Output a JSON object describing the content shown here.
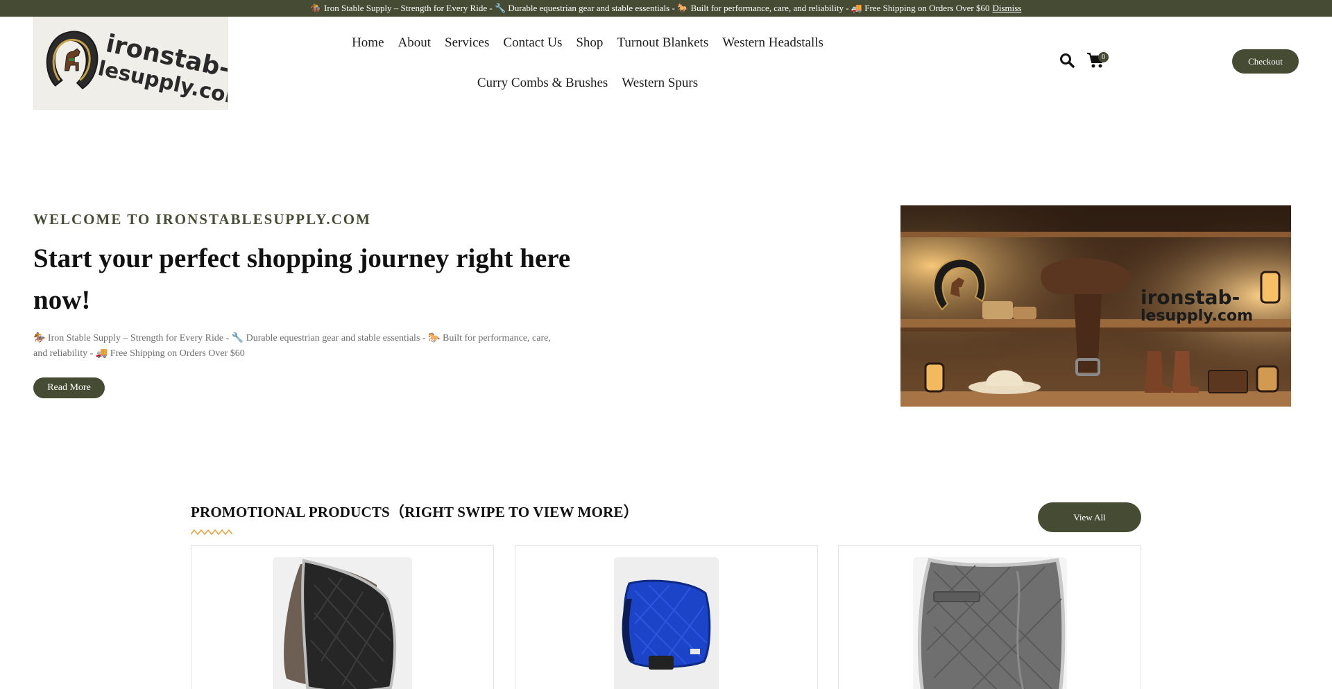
{
  "announcement": {
    "text": "🏇 Iron Stable Supply – Strength for Every Ride - 🔧 Durable equestrian gear and stable essentials - 🐎 Built for performance, care, and reliability - 🚚 Free Shipping on Orders Over $60",
    "dismiss_label": "Dismiss"
  },
  "logo": {
    "line1": "ironstab-",
    "line2": "lesupply.com"
  },
  "nav": {
    "items": [
      {
        "label": "Home"
      },
      {
        "label": "About"
      },
      {
        "label": "Services"
      },
      {
        "label": "Contact Us"
      },
      {
        "label": "Shop"
      },
      {
        "label": "Turnout Blankets"
      },
      {
        "label": "Western Headstalls"
      },
      {
        "label": "Curry Combs & Brushes"
      },
      {
        "label": "Western Spurs"
      }
    ]
  },
  "header": {
    "search_icon": "search-icon",
    "cart_icon": "cart-icon",
    "cart_count": "0",
    "checkout_label": "Checkout"
  },
  "hero": {
    "eyebrow": "WELCOME TO IRONSTABLESUPPLY.COM",
    "title": "Start your perfect shopping journey right here now!",
    "description": "🏇 Iron Stable Supply – Strength for Every Ride - 🔧 Durable equestrian gear and stable essentials - 🐎 Built for performance, care, and reliability - 🚚 Free Shipping on Orders Over $60",
    "read_more_label": "Read More",
    "image_brand_line1": "ironstab-",
    "image_brand_line2": "lesupply.com"
  },
  "promo": {
    "title": "PROMOTIONAL PRODUCTS（RIGHT SWIPE TO VIEW MORE）",
    "view_all_label": "View All",
    "accent_color": "#e8a34a",
    "products": [
      {
        "color": "#2a2a2a",
        "name": "black saddle pad"
      },
      {
        "color": "#1d45c9",
        "name": "blue saddle pad"
      },
      {
        "color": "#6f6f6f",
        "name": "grey saddle pad"
      }
    ]
  },
  "colors": {
    "brand": "#464c33",
    "topbar_bg": "#464c33",
    "text": "#222222"
  }
}
